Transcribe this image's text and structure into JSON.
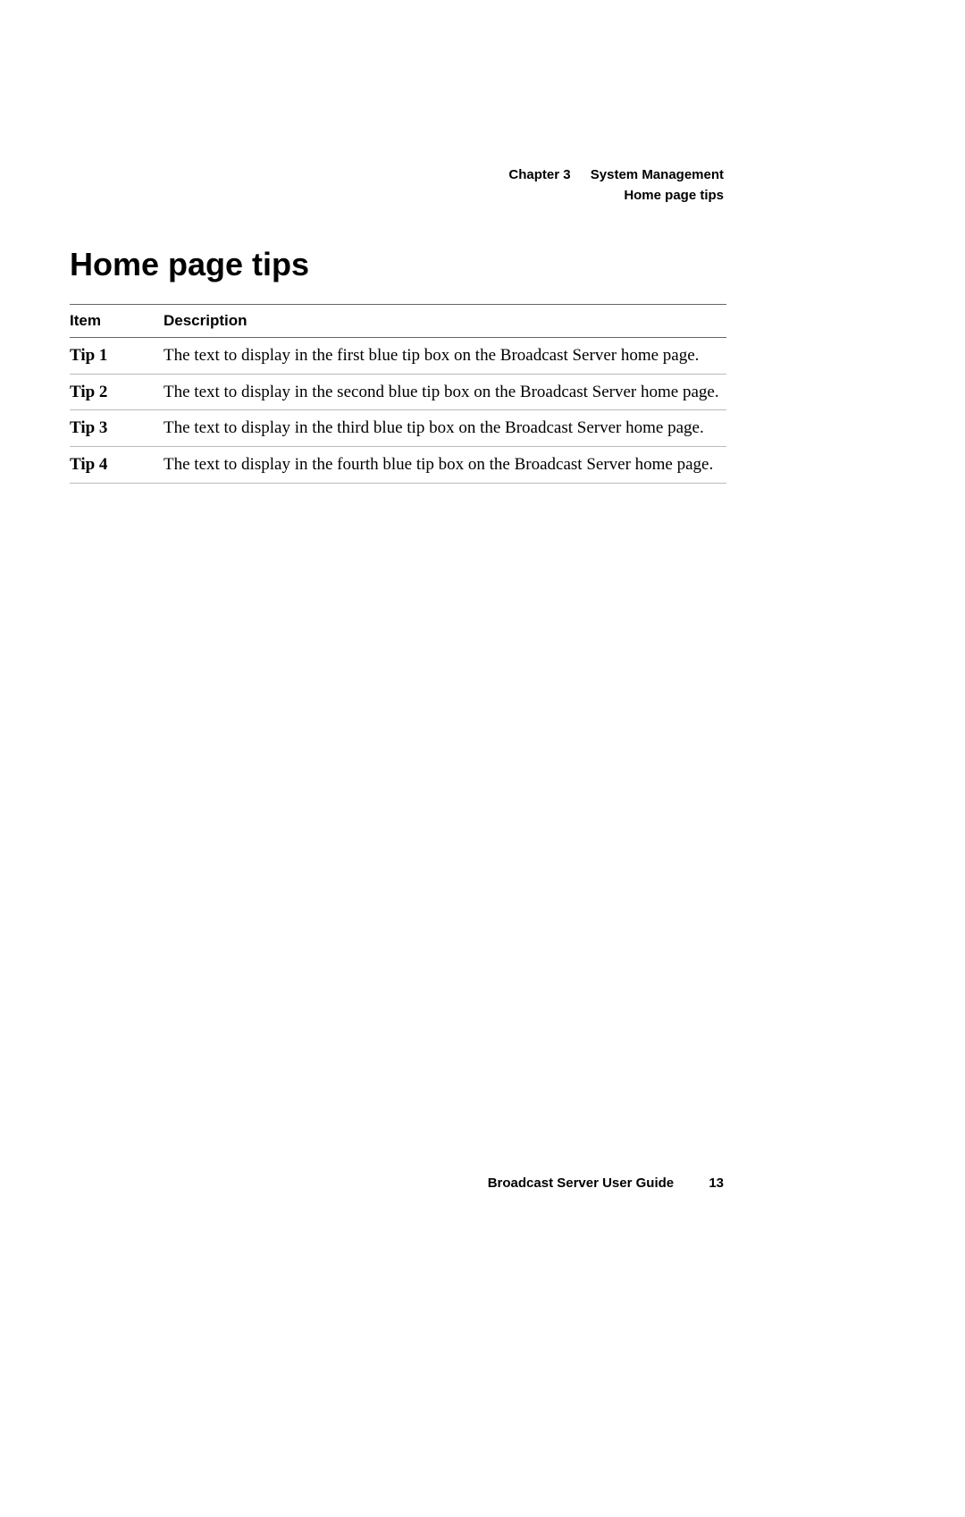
{
  "header": {
    "chapter_label": "Chapter 3",
    "chapter_title": "System Management",
    "subtitle": "Home page tips"
  },
  "title": "Home page tips",
  "table": {
    "headers": {
      "item": "Item",
      "description": "Description"
    },
    "rows": [
      {
        "item": "Tip 1",
        "description": "The text to display in the first blue tip box on the Broadcast Server home page."
      },
      {
        "item": "Tip 2",
        "description": "The text to display in the second blue tip box on the Broadcast Server home page."
      },
      {
        "item": "Tip 3",
        "description": "The text to display in the third blue tip box on the Broadcast Server home page."
      },
      {
        "item": "Tip 4",
        "description": "The text to display in the fourth blue tip box on the Broadcast Server home page."
      }
    ]
  },
  "footer": {
    "doc_title": "Broadcast Server User Guide",
    "page_number": "13"
  }
}
